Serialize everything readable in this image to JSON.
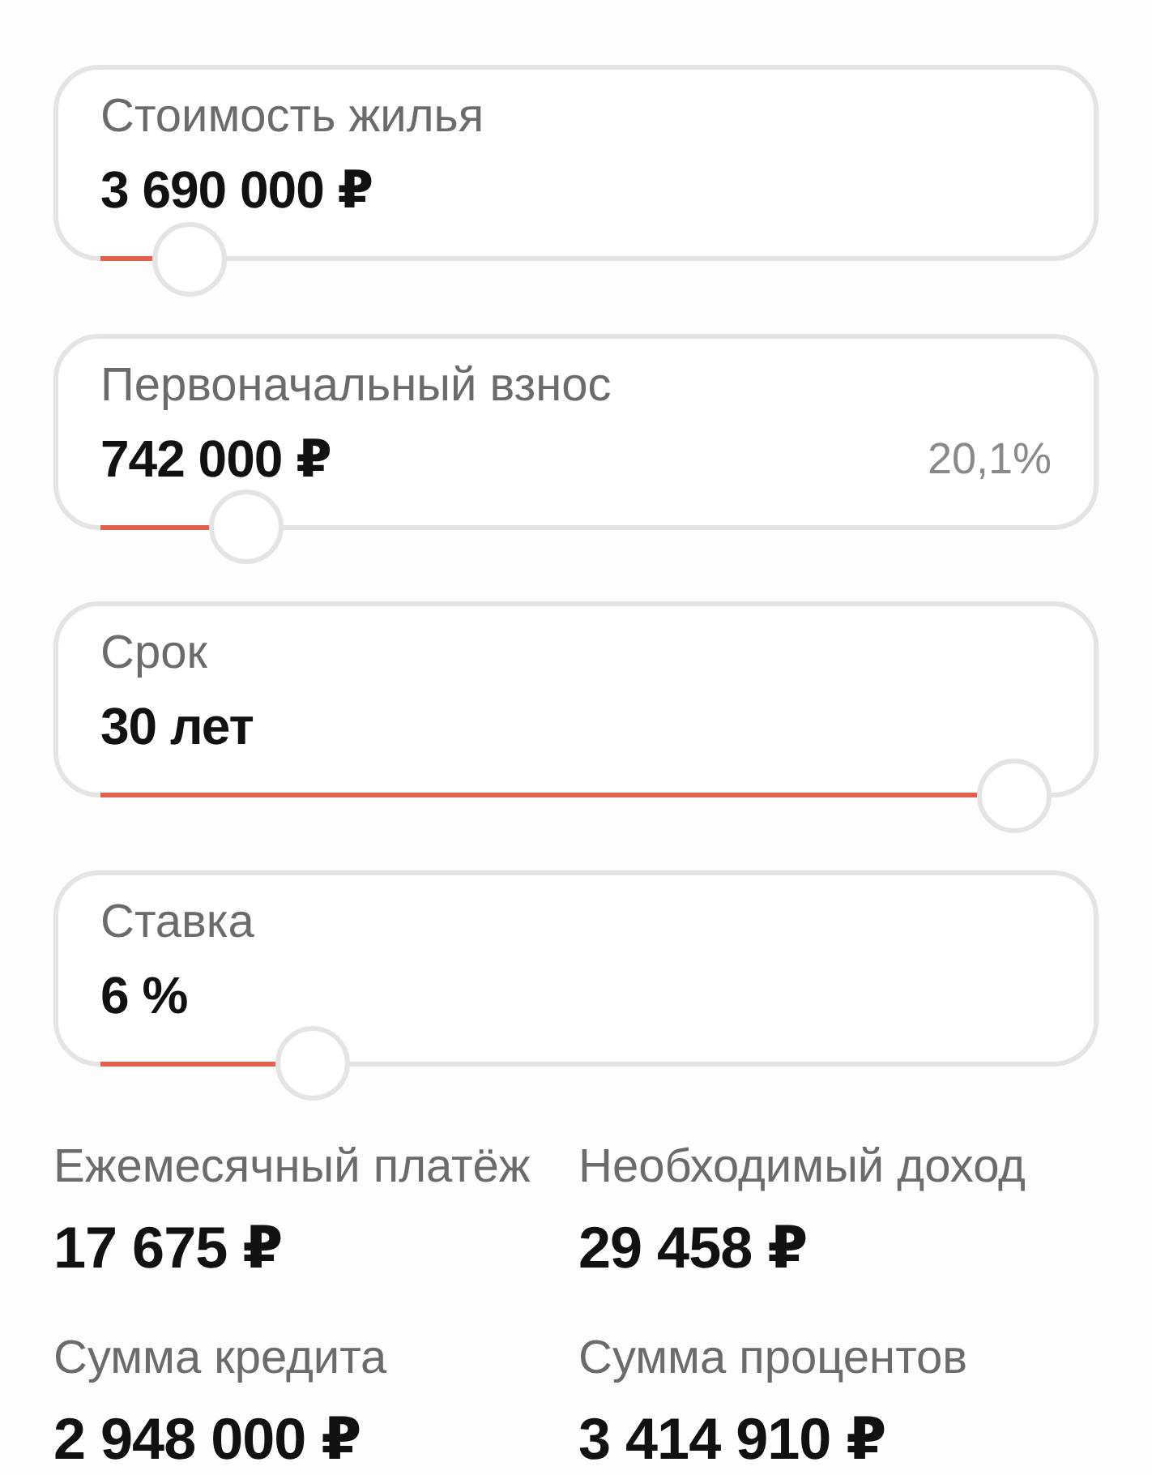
{
  "fields": [
    {
      "label": "Стоимость жилья",
      "value": "3 690 000 ₽",
      "level": 0.06
    },
    {
      "label": "Первоначальный взнос",
      "value": "742 000 ₽",
      "share": "20,1%",
      "level": 0.124
    },
    {
      "label": "Срок",
      "value": "30 лет",
      "level": 1
    },
    {
      "label": "Ставка",
      "value": "6 %",
      "level": 0.2
    }
  ],
  "results": [
    {
      "label": "Ежемесячный платёж",
      "value": "17 675 ₽"
    },
    {
      "label": "Необходимый доход",
      "value": "29 458 ₽"
    },
    {
      "label": "Сумма кредита",
      "value": "2 948 000 ₽"
    },
    {
      "label": "Сумма процентов",
      "value": "3 414 910 ₽"
    }
  ]
}
